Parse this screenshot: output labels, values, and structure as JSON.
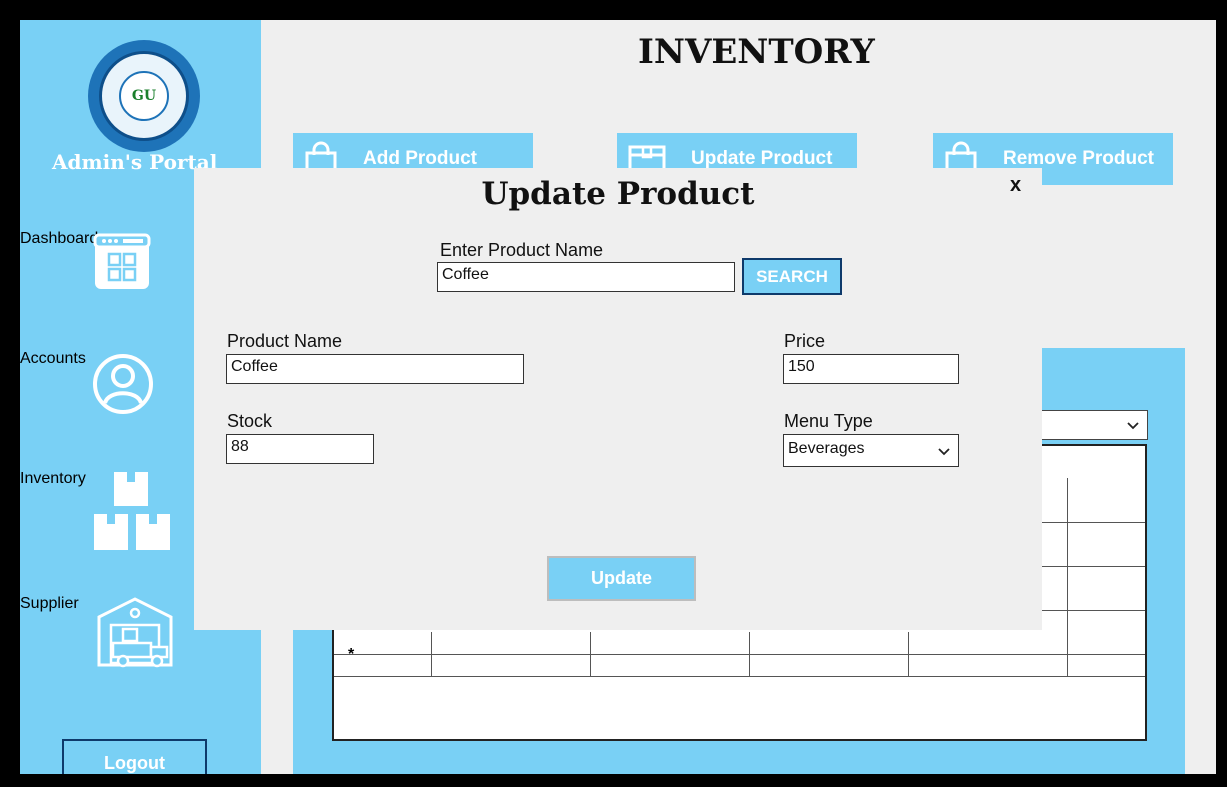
{
  "page": {
    "title": "INVENTORY"
  },
  "sidebar": {
    "logo_text": "GU",
    "portal_title": "Admin's Portal",
    "items": [
      {
        "label": "Dashboard",
        "icon": "dashboard-icon"
      },
      {
        "label": "Accounts",
        "icon": "user-icon"
      },
      {
        "label": "Inventory",
        "icon": "boxes-icon"
      },
      {
        "label": "Supplier",
        "icon": "warehouse-icon"
      }
    ],
    "logout_label": "Logout"
  },
  "top_buttons": [
    {
      "label": "Add Product",
      "icon": "bag-icon"
    },
    {
      "label": "Update Product",
      "icon": "box-icon"
    },
    {
      "label": "Remove Product",
      "icon": "bag-icon"
    }
  ],
  "grid": {
    "new_row_marker": "*"
  },
  "modal": {
    "title": "Update Product",
    "close": "x",
    "search": {
      "label": "Enter Product Name",
      "value": "Coffee",
      "button": "SEARCH"
    },
    "product_name": {
      "label": "Product Name",
      "value": "Coffee"
    },
    "price": {
      "label": "Price",
      "value": "150"
    },
    "stock": {
      "label": "Stock",
      "value": "88"
    },
    "menu_type": {
      "label": "Menu Type",
      "value": "Beverages"
    },
    "update_button": "Update"
  },
  "colors": {
    "accent": "#79d0f5",
    "border_dark": "#0e3a6b",
    "background": "#efefef"
  }
}
